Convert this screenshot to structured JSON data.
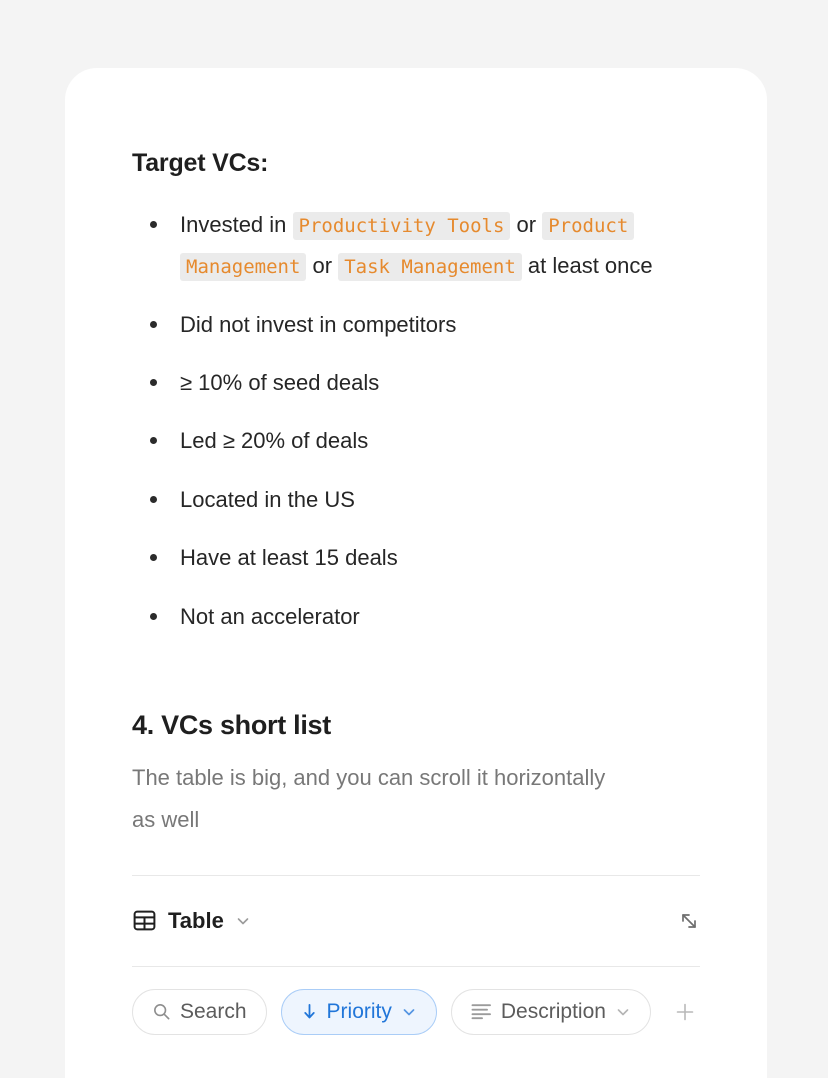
{
  "colors": {
    "page_background": "#f4f4f4",
    "card_background": "#ffffff",
    "code_chip_text": "#e68a2e",
    "code_chip_background": "#ebebeb",
    "accent_blue": "#2176d9",
    "active_pill_background": "#eef5fe",
    "heading_text": "#1f1f1f",
    "body_text": "#262626",
    "muted_text": "#787878",
    "divider": "#e8e8e8"
  },
  "target_vcs": {
    "heading": "Target VCs:",
    "criteria": [
      {
        "parts": [
          {
            "type": "text",
            "value": "Invested in "
          },
          {
            "type": "code",
            "value": "Productivity Tools"
          },
          {
            "type": "text",
            "value": " or "
          },
          {
            "type": "code",
            "value": "Product Management"
          },
          {
            "type": "text",
            "value": " or "
          },
          {
            "type": "code",
            "value": "Task Management"
          },
          {
            "type": "text",
            "value": " at least once"
          }
        ]
      },
      {
        "parts": [
          {
            "type": "text",
            "value": "Did not invest in competitors"
          }
        ]
      },
      {
        "parts": [
          {
            "type": "text",
            "value": "≥ 10% of seed deals"
          }
        ]
      },
      {
        "parts": [
          {
            "type": "text",
            "value": "Led ≥ 20% of deals"
          }
        ]
      },
      {
        "parts": [
          {
            "type": "text",
            "value": "Located in the US"
          }
        ]
      },
      {
        "parts": [
          {
            "type": "text",
            "value": "Have at least 15 deals"
          }
        ]
      },
      {
        "parts": [
          {
            "type": "text",
            "value": "Not an accelerator"
          }
        ]
      }
    ]
  },
  "shortlist_section": {
    "heading": "4. VCs short list",
    "description": "The table is big, and you can scroll it horizontally as well"
  },
  "table_view_bar": {
    "view_icon": "table-grid-icon",
    "view_name": "Table",
    "chevron_icon": "chevron-down-icon",
    "expand_icon": "expand-diagonal-icon"
  },
  "filter_bar": {
    "search": {
      "icon": "search-icon",
      "label": "Search"
    },
    "sort": {
      "icon": "arrow-down-icon",
      "label": "Priority",
      "chevron": "chevron-down-icon",
      "active": true
    },
    "field": {
      "icon": "text-lines-icon",
      "label": "Description",
      "chevron": "chevron-down-icon",
      "active": false
    },
    "add": {
      "icon": "plus-icon"
    }
  }
}
